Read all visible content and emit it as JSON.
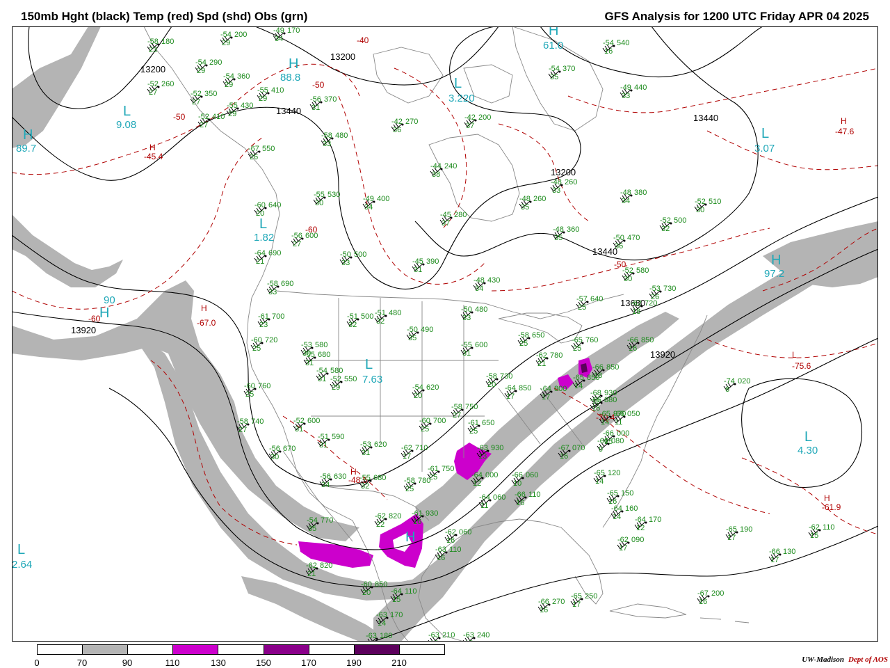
{
  "title_left": "150mb Hght (black) Temp (red) Spd (shd) Obs (grn)",
  "title_right": "GFS Analysis for 1200 UTC Friday  APR 04 2025",
  "colors": {
    "speed_gray": "#b4b4b4",
    "speed_magenta": "#cc00cc",
    "speed_purple": "#8a008a",
    "speed_dark": "#5c005c",
    "height_lines": "#000000",
    "temp_lines": "#b00000",
    "obs": "#1a8a1a",
    "highs_lows": "#20a8b8",
    "borders": "#888888"
  },
  "legend": {
    "ticks": [
      "0",
      "70",
      "90",
      "110",
      "130",
      "150",
      "170",
      "190",
      "210"
    ],
    "fills": [
      "#ffffff",
      "#b4b4b4",
      "#ffffff",
      "#cc00cc",
      "#ffffff",
      "#8a008a",
      "#ffffff",
      "#5c005c",
      "#ffffff"
    ]
  },
  "credit": {
    "org": "UW-Madison",
    "dept": "Dept of AOS"
  },
  "height_contours": [
    "13200",
    "13200",
    "13440",
    "13440",
    "13440",
    "13680",
    "13920",
    "13920"
  ],
  "highs_lows": [
    {
      "letter": "L",
      "value": "9.08"
    },
    {
      "letter": "H",
      "value": "89.7"
    },
    {
      "letter": "H",
      "value": "88.8"
    },
    {
      "letter": "H",
      "value": "61.0"
    },
    {
      "letter": "L",
      "value": "3.220"
    },
    {
      "letter": "L",
      "value": "3.07"
    },
    {
      "letter": "L",
      "value": "1.82"
    },
    {
      "letter": "H",
      "value": "90"
    },
    {
      "letter": "L",
      "value": "7.63"
    },
    {
      "letter": "H",
      "value": "97.2"
    },
    {
      "letter": "L",
      "value": "4.30"
    },
    {
      "letter": "L",
      "value": "2.64"
    },
    {
      "letter": "H",
      "value": ""
    }
  ],
  "temp_labels": [
    "-45.4",
    "-47.6",
    "-50",
    "-50",
    "-60",
    "-67.0",
    "-60",
    "-75.6",
    "-61.9",
    "-40",
    "-70.4",
    "-48.5"
  ],
  "obs": [
    {
      "t": "-54",
      "h": "200",
      "d": "29"
    },
    {
      "t": "-49",
      "h": "170",
      "d": "34"
    },
    {
      "t": "-58",
      "h": "180",
      "d": "23"
    },
    {
      "t": "-54",
      "h": "290",
      "d": "29"
    },
    {
      "t": "-52",
      "h": "260",
      "d": "27"
    },
    {
      "t": "-54",
      "h": "360",
      "d": "29"
    },
    {
      "t": "-55",
      "h": "410",
      "d": "29"
    },
    {
      "t": "-52",
      "h": "350",
      "d": "27"
    },
    {
      "t": "-55",
      "h": "430",
      "d": "29"
    },
    {
      "t": "-52",
      "h": "410",
      "d": "27"
    },
    {
      "t": "-56",
      "h": "370",
      "d": "31"
    },
    {
      "t": "-42",
      "h": "270",
      "d": "36"
    },
    {
      "t": "-42",
      "h": "200",
      "d": "37"
    },
    {
      "t": "-54",
      "h": "370",
      "d": "35"
    },
    {
      "t": "-54",
      "h": "540",
      "d": "16"
    },
    {
      "t": "-49",
      "h": "440",
      "d": "33"
    },
    {
      "t": "-58",
      "h": "480",
      "d": "33"
    },
    {
      "t": "-67",
      "h": "550",
      "d": "26"
    },
    {
      "t": "-44",
      "h": "240",
      "d": "38"
    },
    {
      "t": "-48",
      "h": "260",
      "d": "33"
    },
    {
      "t": "-48",
      "h": "380",
      "d": "34"
    },
    {
      "t": "-52",
      "h": "510",
      "d": "30"
    },
    {
      "t": "-55",
      "h": "530",
      "d": "30"
    },
    {
      "t": "-49",
      "h": "400",
      "d": "34"
    },
    {
      "t": "-48",
      "h": "260",
      "d": "35"
    },
    {
      "t": "-45",
      "h": "280",
      "d": "37"
    },
    {
      "t": "-52",
      "h": "500",
      "d": "32"
    },
    {
      "t": "-60",
      "h": "640",
      "d": "20"
    },
    {
      "t": "-56",
      "h": "600",
      "d": "27"
    },
    {
      "t": "-48",
      "h": "360",
      "d": "35"
    },
    {
      "t": "-50",
      "h": "470",
      "d": "36"
    },
    {
      "t": "-64",
      "h": "690",
      "d": "21"
    },
    {
      "t": "-50",
      "h": "500",
      "d": "33"
    },
    {
      "t": "-45",
      "h": "390",
      "d": "31"
    },
    {
      "t": "-48",
      "h": "430",
      "d": "34"
    },
    {
      "t": "-52",
      "h": "580",
      "d": "30"
    },
    {
      "t": "-58",
      "h": "690",
      "d": "33"
    },
    {
      "t": "-57",
      "h": "640",
      "d": "25"
    },
    {
      "t": "-53",
      "h": "730",
      "d": "26"
    },
    {
      "t": "-61",
      "h": "700",
      "d": "23"
    },
    {
      "t": "-51",
      "h": "500",
      "d": "32"
    },
    {
      "t": "-51",
      "h": "480",
      "d": "32"
    },
    {
      "t": "-50",
      "h": "480",
      "d": "33"
    },
    {
      "t": "-62",
      "h": "720",
      "d": "18"
    },
    {
      "t": "-60",
      "h": "720",
      "d": "25"
    },
    {
      "t": "-53",
      "h": "580",
      "d": "30"
    },
    {
      "t": "-50",
      "h": "490",
      "d": "35"
    },
    {
      "t": "-58",
      "h": "650",
      "d": "25"
    },
    {
      "t": "-65",
      "h": "760",
      "d": "25"
    },
    {
      "t": "-66",
      "h": "850",
      "d": "16"
    },
    {
      "t": "-55",
      "h": "600",
      "d": "31"
    },
    {
      "t": "-62",
      "h": "780",
      "d": "21"
    },
    {
      "t": "-55",
      "h": "680",
      "d": "31"
    },
    {
      "t": "-54",
      "h": "580",
      "d": "31"
    },
    {
      "t": "-52",
      "h": "550",
      "d": "29"
    },
    {
      "t": "-58",
      "h": "730",
      "d": "20"
    },
    {
      "t": "-64",
      "h": "850",
      "d": "17"
    },
    {
      "t": "-65",
      "h": "850",
      "d": "14"
    },
    {
      "t": "-66",
      "h": "850",
      "d": "18"
    },
    {
      "t": "-68",
      "h": "930",
      "d": "12"
    },
    {
      "t": "-74",
      "h": "020",
      "d": "6"
    },
    {
      "t": "-60",
      "h": "760",
      "d": "25"
    },
    {
      "t": "-54",
      "h": "620",
      "d": "20"
    },
    {
      "t": "-64",
      "h": "800",
      "d": "17"
    },
    {
      "t": "-66",
      "h": "880",
      "d": "16"
    },
    {
      "t": "-65",
      "h": "970",
      "d": "14"
    },
    {
      "t": "-58",
      "h": "750",
      "d": "27"
    },
    {
      "t": "-58",
      "h": "740",
      "d": "27"
    },
    {
      "t": "-52",
      "h": "600",
      "d": "31"
    },
    {
      "t": "-60",
      "h": "700",
      "d": "25"
    },
    {
      "t": "-61",
      "h": "650",
      "d": "25"
    },
    {
      "t": "-66",
      "h": "000",
      "d": "15"
    },
    {
      "t": "-66",
      "h": "050",
      "d": "11"
    },
    {
      "t": "-51",
      "h": "590",
      "d": "31"
    },
    {
      "t": "-56",
      "h": "670",
      "d": "30"
    },
    {
      "t": "-53",
      "h": "620",
      "d": "31"
    },
    {
      "t": "-62",
      "h": "710",
      "d": "17"
    },
    {
      "t": "-61",
      "h": "750",
      "d": "25"
    },
    {
      "t": "-63",
      "h": "930",
      "d": "13"
    },
    {
      "t": "-66",
      "h": "080",
      "d": "9"
    },
    {
      "t": "-67",
      "h": "070",
      "d": "16"
    },
    {
      "t": "-56",
      "h": "630",
      "d": "34"
    },
    {
      "t": "-55",
      "h": "680",
      "d": "32"
    },
    {
      "t": "-58",
      "h": "780",
      "d": "25"
    },
    {
      "t": "-64",
      "h": "000",
      "d": "12"
    },
    {
      "t": "-66",
      "h": "060",
      "d": "10"
    },
    {
      "t": "-65",
      "h": "120",
      "d": "14"
    },
    {
      "t": "-64",
      "h": "060",
      "d": "11"
    },
    {
      "t": "-66",
      "h": "110",
      "d": "16"
    },
    {
      "t": "-65",
      "h": "150",
      "d": "16"
    },
    {
      "t": "-64",
      "h": "160",
      "d": "14"
    },
    {
      "t": "-54",
      "h": "770",
      "d": "35"
    },
    {
      "t": "-62",
      "h": "820",
      "d": "22"
    },
    {
      "t": "-61",
      "h": "930",
      "d": "16"
    },
    {
      "t": "-64",
      "h": "170",
      "d": "12"
    },
    {
      "t": "-62",
      "h": "110",
      "d": "15"
    },
    {
      "t": "-62",
      "h": "060",
      "d": "16"
    },
    {
      "t": "-65",
      "h": "190",
      "d": "17"
    },
    {
      "t": "-62",
      "h": "090",
      "d": "17"
    },
    {
      "t": "-63",
      "h": "110",
      "d": "16"
    },
    {
      "t": "-66",
      "h": "130",
      "d": "17"
    },
    {
      "t": "-62",
      "h": "820",
      "d": "21"
    },
    {
      "t": "-60",
      "h": "850",
      "d": "20"
    },
    {
      "t": "-64",
      "h": "110",
      "d": "15"
    },
    {
      "t": "-66",
      "h": "270",
      "d": "16"
    },
    {
      "t": "-65",
      "h": "250",
      "d": "17"
    },
    {
      "t": "-67",
      "h": "200",
      "d": "16"
    },
    {
      "t": "-63",
      "h": "170",
      "d": "14"
    },
    {
      "t": "-63",
      "h": "180",
      "d": "14"
    },
    {
      "t": "-63",
      "h": "210",
      "d": "15"
    },
    {
      "t": "-63",
      "h": "240",
      "d": "15"
    }
  ]
}
